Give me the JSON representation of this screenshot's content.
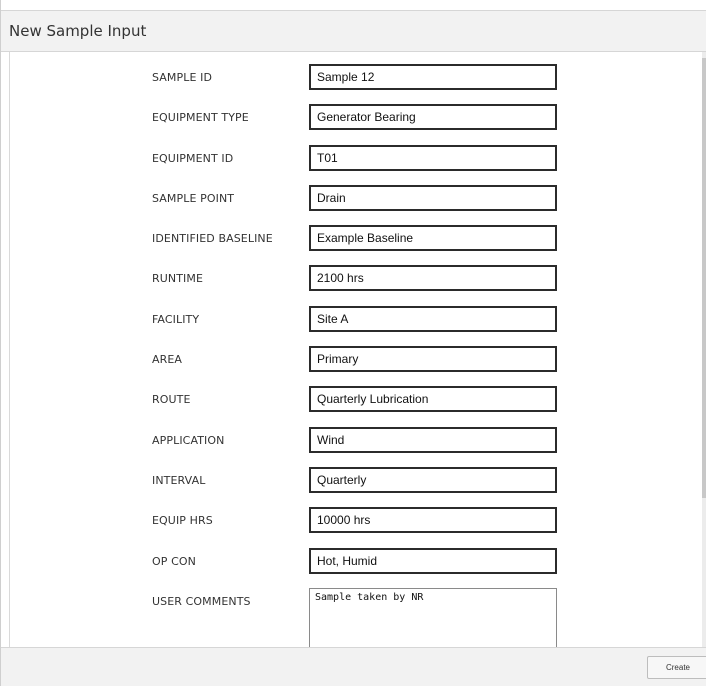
{
  "dialog": {
    "title": "New Sample Input"
  },
  "form": {
    "fields": [
      {
        "label": "SAMPLE ID",
        "value": "Sample 12"
      },
      {
        "label": "EQUIPMENT TYPE",
        "value": "Generator Bearing"
      },
      {
        "label": "EQUIPMENT ID",
        "value": "T01"
      },
      {
        "label": "SAMPLE POINT",
        "value": "Drain"
      },
      {
        "label": "IDENTIFIED BASELINE",
        "value": "Example Baseline"
      },
      {
        "label": "RUNTIME",
        "value": "2100 hrs"
      },
      {
        "label": "FACILITY",
        "value": "Site A"
      },
      {
        "label": "AREA",
        "value": "Primary"
      },
      {
        "label": "ROUTE",
        "value": "Quarterly Lubrication"
      },
      {
        "label": "APPLICATION",
        "value": "Wind"
      },
      {
        "label": "INTERVAL",
        "value": "Quarterly"
      },
      {
        "label": "EQUIP HRS",
        "value": "10000 hrs"
      },
      {
        "label": "OP CON",
        "value": "Hot, Humid"
      }
    ],
    "comments": {
      "label": "USER COMMENTS",
      "value": "Sample taken by NR"
    }
  },
  "footer": {
    "create_label": "Create"
  }
}
